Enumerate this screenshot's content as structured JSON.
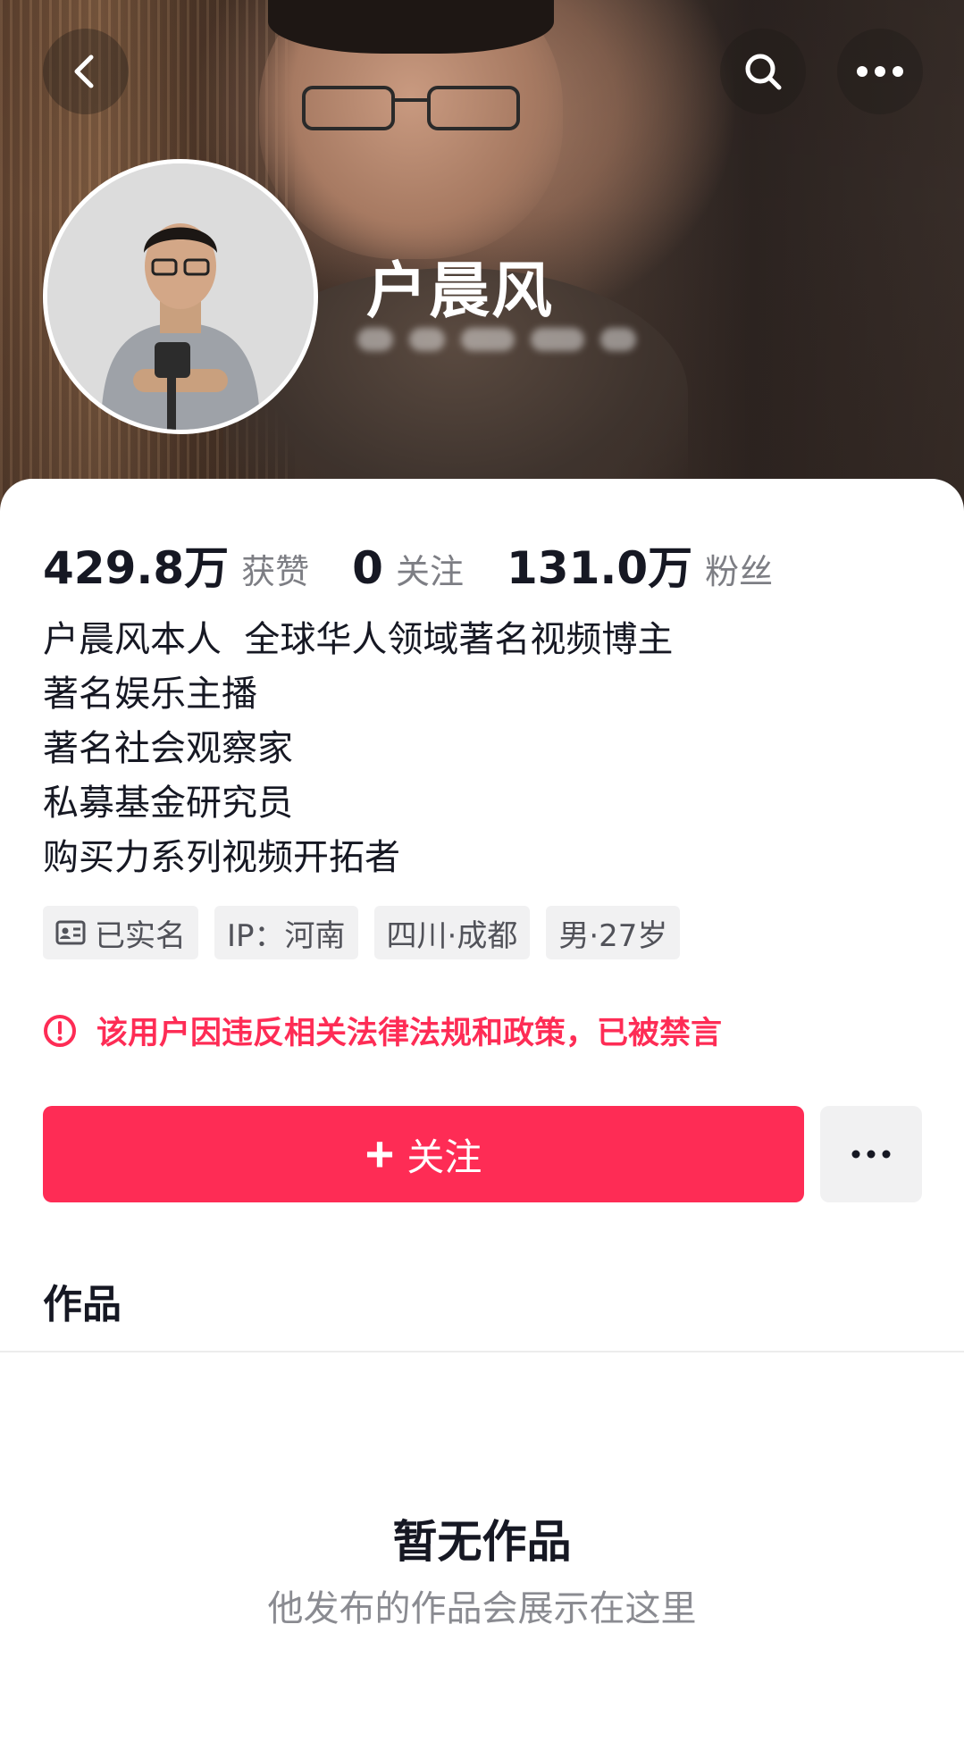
{
  "header": {
    "nickname": "户晨风",
    "back_icon": "chevron-left-icon",
    "search_icon": "search-icon",
    "more_icon": "more-horizontal-icon"
  },
  "stats": [
    {
      "value": "429.8万",
      "label": "获赞"
    },
    {
      "value": "0",
      "label": "关注"
    },
    {
      "value": "131.0万",
      "label": "粉丝"
    }
  ],
  "bio": [
    "户晨风本人  全球华人领域著名视频博主",
    "著名娱乐主播",
    "著名社会观察家",
    "私募基金研究员",
    "购买力系列视频开拓者"
  ],
  "tags": {
    "verified": "已实名",
    "verified_icon": "id-card-icon",
    "ip": "IP：河南",
    "location": "四川·成都",
    "gender_age": "男·27岁"
  },
  "warning": {
    "text": "该用户因违反相关法律法规和政策，已被禁言",
    "icon": "alert-circle-icon",
    "color": "#fe2c55"
  },
  "actions": {
    "follow_plus": "+",
    "follow_label": "关注",
    "more_icon": "more-horizontal-icon",
    "accent": "#fe2c55"
  },
  "works": {
    "title": "作品",
    "empty_title": "暂无作品",
    "empty_subtitle": "他发布的作品会展示在这里"
  }
}
